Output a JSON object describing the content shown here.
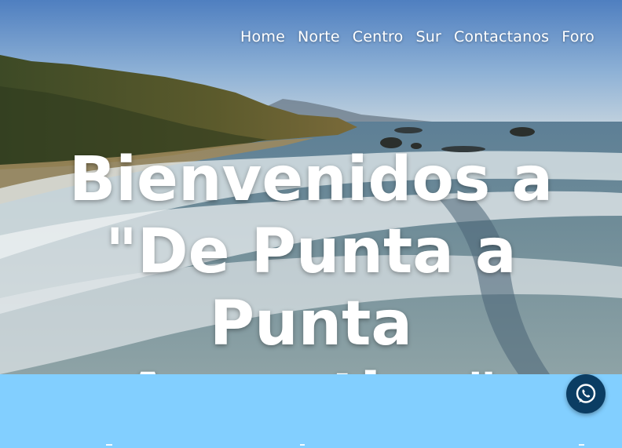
{
  "nav": {
    "items": [
      {
        "label": "Home"
      },
      {
        "label": "Norte"
      },
      {
        "label": "Centro"
      },
      {
        "label": "Sur"
      },
      {
        "label": "Contactanos"
      },
      {
        "label": "Foro"
      }
    ]
  },
  "hero": {
    "line1": "Bienvenidos a",
    "line2": "\"De Punta a Punta",
    "line3": "Argentina\""
  },
  "colors": {
    "section_background": "#82cfff",
    "whatsapp_button": "#0b3d63"
  },
  "floating": {
    "icon": "whatsapp-icon"
  }
}
